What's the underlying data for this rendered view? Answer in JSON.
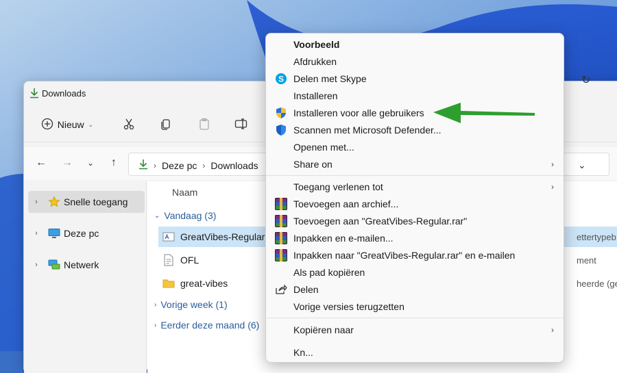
{
  "window": {
    "title": "Downloads"
  },
  "toolbar": {
    "new_label": "Nieuw"
  },
  "address": {
    "crumbs": [
      "Deze pc",
      "Downloads"
    ]
  },
  "navpane": {
    "items": [
      {
        "label": "Snelle toegang",
        "icon": "star-icon"
      },
      {
        "label": "Deze pc",
        "icon": "monitor-icon"
      },
      {
        "label": "Netwerk",
        "icon": "network-icon"
      }
    ]
  },
  "content": {
    "column_name": "Naam",
    "groups": [
      {
        "label": "Vandaag (3)"
      },
      {
        "label": "Vorige week (1)"
      },
      {
        "label": "Eerder deze maand (6)"
      }
    ],
    "files": [
      {
        "name": "GreatVibes-Regular",
        "type": "ettertypeb...",
        "icon": "font-file-icon"
      },
      {
        "name": "OFL",
        "type": "ment",
        "icon": "text-file-icon"
      },
      {
        "name": "great-vibes",
        "type": "heerde (ge...",
        "icon": "folder-icon"
      }
    ]
  },
  "menu": {
    "items": [
      {
        "label": "Voorbeeld",
        "icon": ""
      },
      {
        "label": "Afdrukken",
        "icon": ""
      },
      {
        "label": "Delen met Skype",
        "icon": "skype-icon"
      },
      {
        "label": "Installeren",
        "icon": ""
      },
      {
        "label": "Installeren voor alle gebruikers",
        "icon": "uac-shield-icon"
      },
      {
        "label": "Scannen met Microsoft Defender...",
        "icon": "defender-shield-icon"
      },
      {
        "label": "Openen met...",
        "icon": ""
      },
      {
        "label": "Share on",
        "icon": ""
      },
      {
        "label": "Toegang verlenen tot",
        "icon": ""
      },
      {
        "label": "Toevoegen aan archief...",
        "icon": "winrar-icon"
      },
      {
        "label": "Toevoegen aan \"GreatVibes-Regular.rar\"",
        "icon": "winrar-icon"
      },
      {
        "label": "Inpakken en e-mailen...",
        "icon": "winrar-icon"
      },
      {
        "label": "Inpakken naar \"GreatVibes-Regular.rar\" en e-mailen",
        "icon": "winrar-icon"
      },
      {
        "label": "Als pad kopiëren",
        "icon": ""
      },
      {
        "label": "Delen",
        "icon": "share-icon"
      },
      {
        "label": "Vorige versies terugzetten",
        "icon": ""
      },
      {
        "label": "Kopiëren naar",
        "icon": ""
      },
      {
        "label": "Kn...",
        "icon": ""
      }
    ]
  },
  "annotation": {
    "arrow_color": "#2e9e2e"
  }
}
